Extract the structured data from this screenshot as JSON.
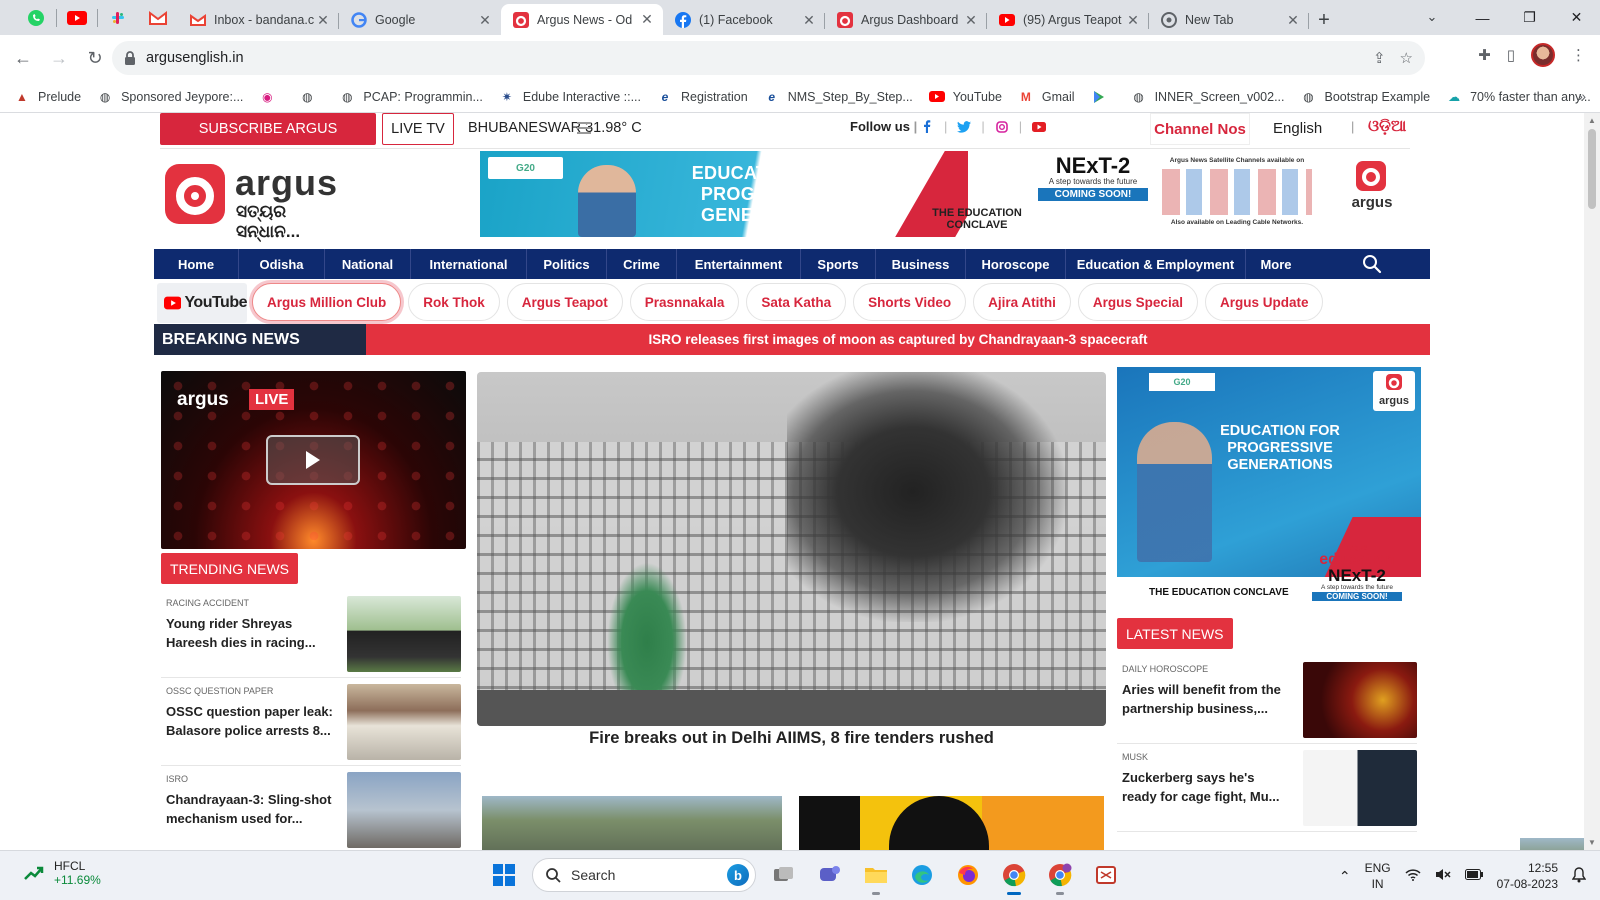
{
  "browser": {
    "pinned_tabs": [
      "whatsapp-icon",
      "youtube-icon",
      "slack-icon",
      "gmail-icon"
    ],
    "tabs": [
      {
        "title": "Inbox - bandana.c",
        "icon": "gmail-icon",
        "active": false
      },
      {
        "title": "Google",
        "icon": "google-icon",
        "active": false
      },
      {
        "title": "Argus News - Od",
        "icon": "argus-icon",
        "active": true
      },
      {
        "title": "(1) Facebook",
        "icon": "facebook-icon",
        "active": false
      },
      {
        "title": "Argus Dashboard",
        "icon": "argus-icon",
        "active": false
      },
      {
        "title": "(95) Argus Teapot",
        "icon": "youtube-icon",
        "active": false
      },
      {
        "title": "New Tab",
        "icon": "chrome-icon",
        "active": false
      }
    ],
    "url": "argusenglish.in",
    "bookmarks": [
      {
        "label": "Prelude",
        "icon": "prelude-icon"
      },
      {
        "label": "Sponsored Jeypore:...",
        "icon": "globe-icon"
      },
      {
        "label": "",
        "icon": "app-icon"
      },
      {
        "label": "",
        "icon": "globe-icon"
      },
      {
        "label": "PCAP: Programmin...",
        "icon": "globe-icon"
      },
      {
        "label": "Edube Interactive ::...",
        "icon": "edube-icon"
      },
      {
        "label": "Registration",
        "icon": "edge-icon"
      },
      {
        "label": "NMS_Step_By_Step...",
        "icon": "edge-icon"
      },
      {
        "label": "YouTube",
        "icon": "youtube-icon"
      },
      {
        "label": "Gmail",
        "icon": "gmail-icon"
      },
      {
        "label": "",
        "icon": "play-store-icon"
      },
      {
        "label": "INNER_Screen_v002...",
        "icon": "globe-icon"
      },
      {
        "label": "Bootstrap Example",
        "icon": "globe-icon"
      },
      {
        "label": "70% faster than any...",
        "icon": "cloud-icon"
      }
    ]
  },
  "site": {
    "topbar": {
      "subscribe": "SUBSCRIBE ARGUS",
      "live_tv": "LIVE TV",
      "weather": "BHUBANESWAR 31.98° C",
      "follow_us": "Follow us",
      "channel_nos": "Channel Nos",
      "lang_en": "English",
      "lang_or": "ଓଡ଼ିଆ"
    },
    "logo": {
      "name": "argus",
      "tagline": "ସତ୍ୟର ସନ୍ଧାନ..."
    },
    "banner": {
      "headline": "EDUCATION FOR PROGRESSIVE GENERATIONS",
      "g20": "G20",
      "conclave": "THE EDUCATION CONCLAVE",
      "next_brand": "argus",
      "next_t1": "education",
      "next_t2": "NExT-2",
      "next_tag": "A step towards the future",
      "coming": "COMING SOON!",
      "sat_head": "Argus News Satellite Channels available on",
      "sat_foot": "Also available on Leading Cable Networks."
    },
    "nav": [
      "Home",
      "Odisha",
      "National",
      "International",
      "Politics",
      "Crime",
      "Entertainment",
      "Sports",
      "Business",
      "Horoscope",
      "Education & Employment",
      "More"
    ],
    "youtube_label": "YouTube",
    "chips": [
      "Argus Million Club",
      "Rok Thok",
      "Argus Teapot",
      "Prasnnakala",
      "Sata Katha",
      "Shorts Video",
      "Ajira Atithi",
      "Argus Special",
      "Argus Update"
    ],
    "breaking": {
      "label": "BREAKING NEWS",
      "text": "ISRO releases first images of moon as captured by Chandrayaan-3 spacecraft"
    },
    "live": {
      "brand": "argus",
      "tag": "LIVE"
    },
    "hero": {
      "caption": "Fire breaks out in Delhi AIIMS, 8 fire tenders rushed"
    },
    "trending": {
      "title": "TRENDING NEWS",
      "items": [
        {
          "category": "RACING ACCIDENT",
          "headline": "Young rider Shreyas Hareesh dies in racing..."
        },
        {
          "category": "OSSC QUESTION PAPER",
          "headline": "OSSC question paper leak: Balasore police arrests 8..."
        },
        {
          "category": "ISRO",
          "headline": "Chandrayaan-3: Sling-shot mechanism used for..."
        }
      ]
    },
    "side_ad": {
      "g20": "G20",
      "text": "EDUCATION FOR PROGRESSIVE GENERATIONS",
      "conclave": "THE EDUCATION CONCLAVE",
      "n1": "argus",
      "n2": "education",
      "n3": "NExT-2",
      "n4": "A step towards the future",
      "n5": "COMING SOON!"
    },
    "latest": {
      "title": "LATEST NEWS",
      "items": [
        {
          "category": "DAILY HOROSCOPE",
          "headline": "Aries will benefit from the partnership business,..."
        },
        {
          "category": "MUSK",
          "headline": "Zuckerberg says he's ready for cage fight, Mu..."
        }
      ]
    }
  },
  "taskbar": {
    "stock_name": "HFCL",
    "stock_change": "+11.69%",
    "search_label": "Search",
    "lang_1": "ENG",
    "lang_2": "IN",
    "time": "12:55",
    "date": "07-08-2023"
  },
  "colors": {
    "brand_red": "#e3323f",
    "nav_blue": "#0e2a6f",
    "breaking_dark": "#1f2a44"
  }
}
